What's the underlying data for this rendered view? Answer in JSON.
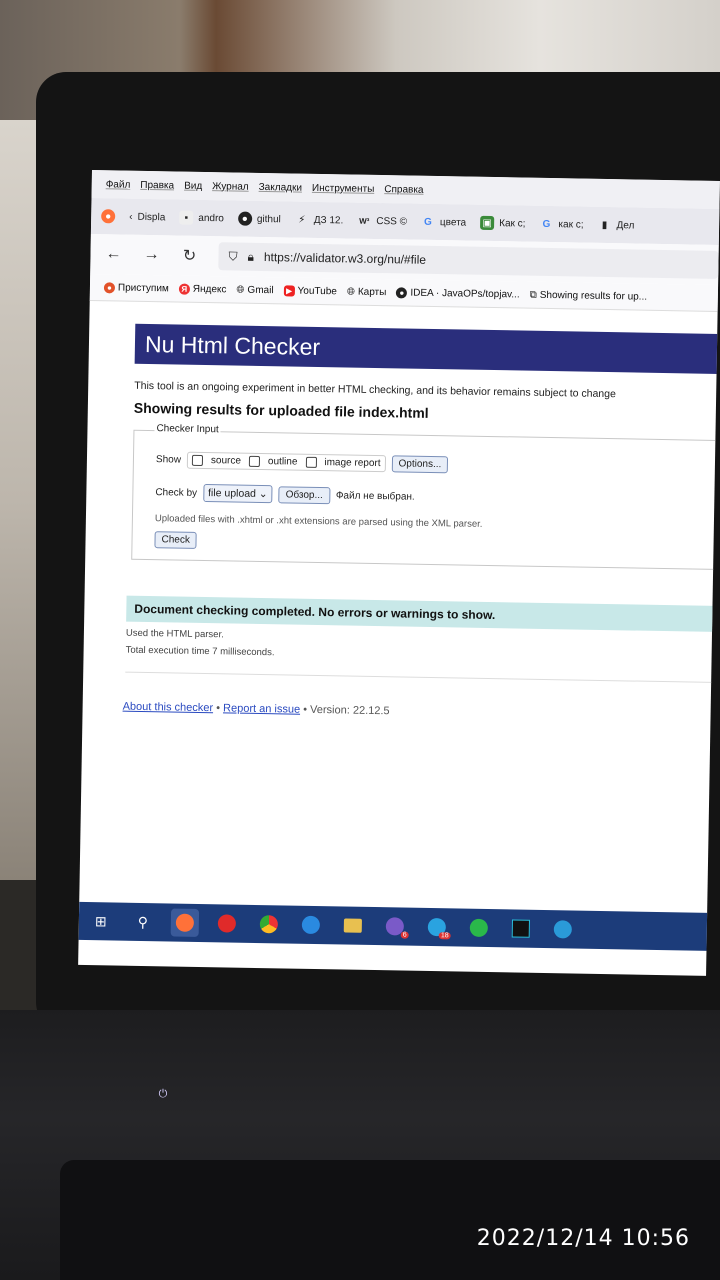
{
  "browser": {
    "menu": [
      "Файл",
      "Правка",
      "Вид",
      "Журнал",
      "Закладки",
      "Инструменты",
      "Справка"
    ],
    "tabs": [
      {
        "label": "Displa",
        "icon": "back-icon"
      },
      {
        "label": "andro",
        "icon": "tab-icon"
      },
      {
        "label": "githul",
        "icon": "github-icon"
      },
      {
        "label": "ДЗ 12.",
        "icon": "tab-icon"
      },
      {
        "label": "CSS ©",
        "icon": "w3-icon"
      },
      {
        "label": "цвета",
        "icon": "google-icon"
      },
      {
        "label": "Как с;",
        "icon": "tab-icon"
      },
      {
        "label": "как с;",
        "icon": "google-icon"
      },
      {
        "label": "Дел",
        "icon": "tab-icon"
      }
    ],
    "url": "https://validator.w3.org/nu/#file",
    "bookmarks": [
      {
        "label": "Приступим",
        "color": "#e2522a"
      },
      {
        "label": "Яндекс",
        "color": "#e33"
      },
      {
        "label": "Gmail",
        "color": "#555"
      },
      {
        "label": "YouTube",
        "color": "#e22"
      },
      {
        "label": "Карты",
        "color": "#555"
      },
      {
        "label": "IDEA · JavaOPs/topjav...",
        "color": "#222"
      },
      {
        "label": "Showing results for up...",
        "color": "#333"
      }
    ]
  },
  "page": {
    "title": "Nu Html Checker",
    "intro": "This tool is an ongoing experiment in better HTML checking, and its behavior remains subject to change",
    "results_heading": "Showing results for uploaded file index.html",
    "checker_input": {
      "legend": "Checker Input",
      "show_label": "Show",
      "options": [
        "source",
        "outline",
        "image report"
      ],
      "options_button": "Options...",
      "check_by_label": "Check by",
      "check_by_value": "file upload",
      "browse_button": "Обзор...",
      "file_status": "Файл не выбран.",
      "note": "Uploaded files with .xhtml or .xht extensions are parsed using the XML parser.",
      "check_button": "Check"
    },
    "success_message": "Document checking completed. No errors or warnings to show.",
    "parser_note": "Used the HTML parser.",
    "execution_time": "Total execution time 7 milliseconds.",
    "footer": {
      "about": "About this checker",
      "separator": " • ",
      "report": "Report an issue",
      "version": " • Version: 22.12.5"
    }
  },
  "taskbar": {
    "badges": {
      "viber": "6",
      "telegram": "18"
    }
  },
  "timestamp": "2022/12/14  10:56"
}
